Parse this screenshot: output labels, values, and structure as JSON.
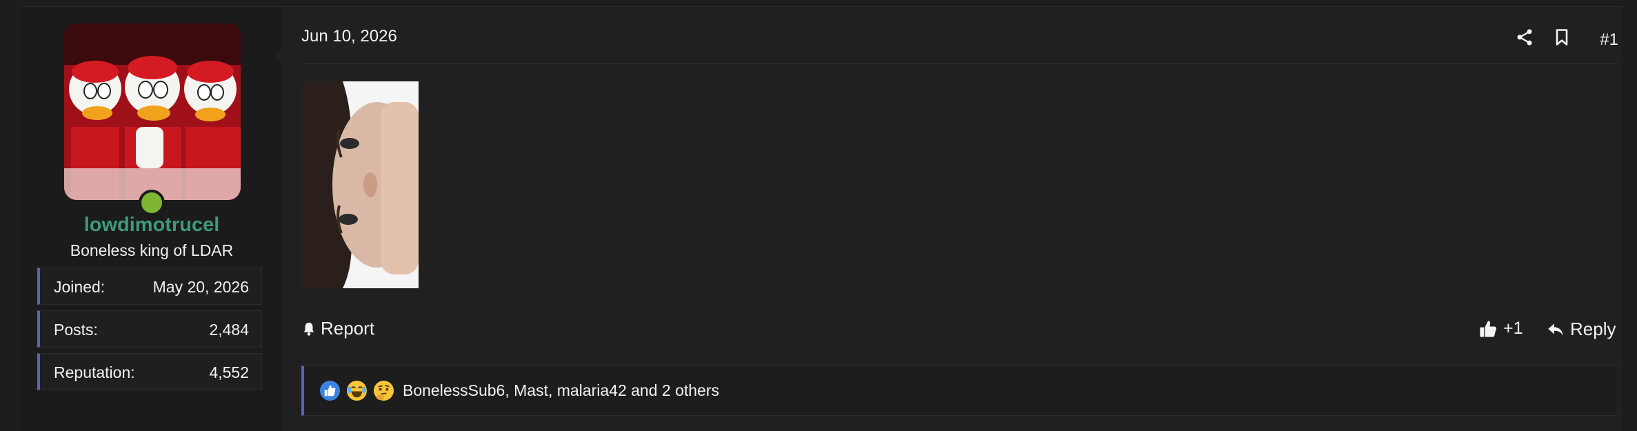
{
  "post": {
    "date": "Jun 10, 2026",
    "number": "#1",
    "actions": {
      "share_icon": "share-icon",
      "bookmark_icon": "bookmark-icon"
    }
  },
  "user": {
    "name": "lowdimotrucel",
    "title": "Boneless king of LDAR",
    "online": true,
    "stats": [
      {
        "label": "Joined:",
        "value": "May 20, 2026"
      },
      {
        "label": "Posts:",
        "value": "2,484"
      },
      {
        "label": "Reputation:",
        "value": "4,552"
      }
    ]
  },
  "footer": {
    "report_label": "Report",
    "like_label": "+1",
    "reply_label": "Reply"
  },
  "reactions": {
    "icons": [
      "like-emoji-icon",
      "laugh-cry-emoji-icon",
      "thinking-emoji-icon"
    ],
    "text": "BonelessSub6, Mast, malaria42 and 2 others"
  },
  "colors": {
    "username": "#3f9a7a",
    "accent_border": "#5a63b8",
    "online": "#7fb531",
    "background": "#202020"
  }
}
